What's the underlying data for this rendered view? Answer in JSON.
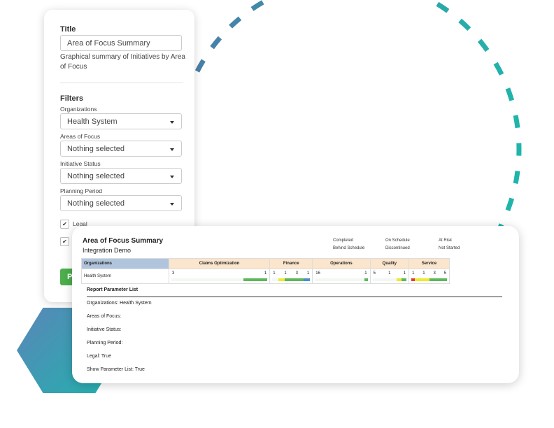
{
  "panel": {
    "title_label": "Title",
    "title_value": "Area of Focus Summary",
    "description": "Graphical summary of Initiatives by Area of Focus",
    "filters_label": "Filters",
    "filters": [
      {
        "label": "Organizations",
        "value": "Health System"
      },
      {
        "label": "Areas of Focus",
        "value": "Nothing selected"
      },
      {
        "label": "Initiative Status",
        "value": "Nothing selected"
      },
      {
        "label": "Planning Period",
        "value": "Nothing selected"
      }
    ],
    "checkbox_legal": "Legal",
    "button": "Pr"
  },
  "report": {
    "title": "Area of Focus Summary",
    "subtitle": "Integration Demo",
    "legend": [
      "Completed",
      "On Schedule",
      "At Risk",
      "Behind Schedule",
      "Discontinued",
      "Not Started"
    ],
    "org_header": "Organizations",
    "row_label": "Health System",
    "columns": [
      {
        "name": "Claims Optimization",
        "numbers": [
          "3",
          "1"
        ],
        "segments": [
          {
            "v": 3,
            "c": "#f4f8f4"
          },
          {
            "v": 1,
            "c": "#5cb85c"
          }
        ]
      },
      {
        "name": "Finance",
        "numbers": [
          "1",
          "1",
          "3",
          "1"
        ],
        "segments": [
          {
            "v": 1,
            "c": "#f4f8f4"
          },
          {
            "v": 1,
            "c": "#eeea2e"
          },
          {
            "v": 3,
            "c": "#5cb85c"
          },
          {
            "v": 1,
            "c": "#4a90d0"
          }
        ]
      },
      {
        "name": "Operations",
        "numbers": [
          "16",
          "1"
        ],
        "segments": [
          {
            "v": 16,
            "c": "#f4f8f4"
          },
          {
            "v": 1,
            "c": "#5cb85c"
          }
        ]
      },
      {
        "name": "Quality",
        "numbers": [
          "5",
          "1",
          "1"
        ],
        "segments": [
          {
            "v": 5,
            "c": "#f4f8f4"
          },
          {
            "v": 1,
            "c": "#eeea2e"
          },
          {
            "v": 1,
            "c": "#5cb85c"
          }
        ]
      },
      {
        "name": "Service",
        "numbers": [
          "1",
          "1",
          "3",
          "5"
        ],
        "segments": [
          {
            "v": 1,
            "c": "#e53935"
          },
          {
            "v": 1,
            "c": "#eeea2e"
          },
          {
            "v": 3,
            "c": "#eeea2e"
          },
          {
            "v": 5,
            "c": "#5cb85c"
          }
        ]
      }
    ],
    "param_title": "Report Parameter List",
    "params": [
      "Organizations:  Health System",
      "Areas of Focus:",
      "Initiative Status:",
      "Planning Period:",
      "Legal:  True",
      "Show Parameter List:  True"
    ]
  }
}
